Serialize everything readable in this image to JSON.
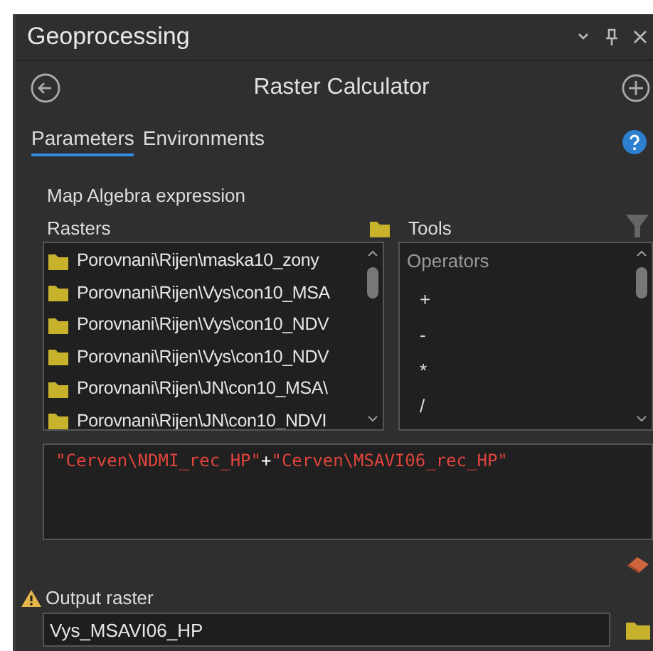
{
  "window": {
    "title": "Geoprocessing"
  },
  "tool": {
    "title": "Raster Calculator"
  },
  "tabs": [
    {
      "label": "Parameters",
      "selected": true
    },
    {
      "label": "Environments",
      "selected": false
    }
  ],
  "expression_label": "Map Algebra expression",
  "rasters": {
    "label": "Rasters",
    "items": [
      "Porovnani\\Rijen\\maska10_zony",
      "Porovnani\\Rijen\\Vys\\con10_MSA",
      "Porovnani\\Rijen\\Vys\\con10_NDV",
      "Porovnani\\Rijen\\Vys\\con10_NDV",
      "Porovnani\\Rijen\\JN\\con10_MSA\\",
      "Porovnani\\Rijen\\JN\\con10_NDVI"
    ]
  },
  "tools": {
    "label": "Tools",
    "group": "Operators",
    "items": [
      "+",
      "-",
      "*",
      "/"
    ]
  },
  "expression": [
    {
      "kind": "string",
      "text": "\"Cerven\\NDMI_rec_HP\""
    },
    {
      "kind": "operator",
      "text": "+"
    },
    {
      "kind": "string",
      "text": "\"Cerven\\MSAVI06_rec_HP\""
    }
  ],
  "output": {
    "label": "Output raster",
    "value": "Vys_MSAVI06_HP",
    "warning": true
  }
}
